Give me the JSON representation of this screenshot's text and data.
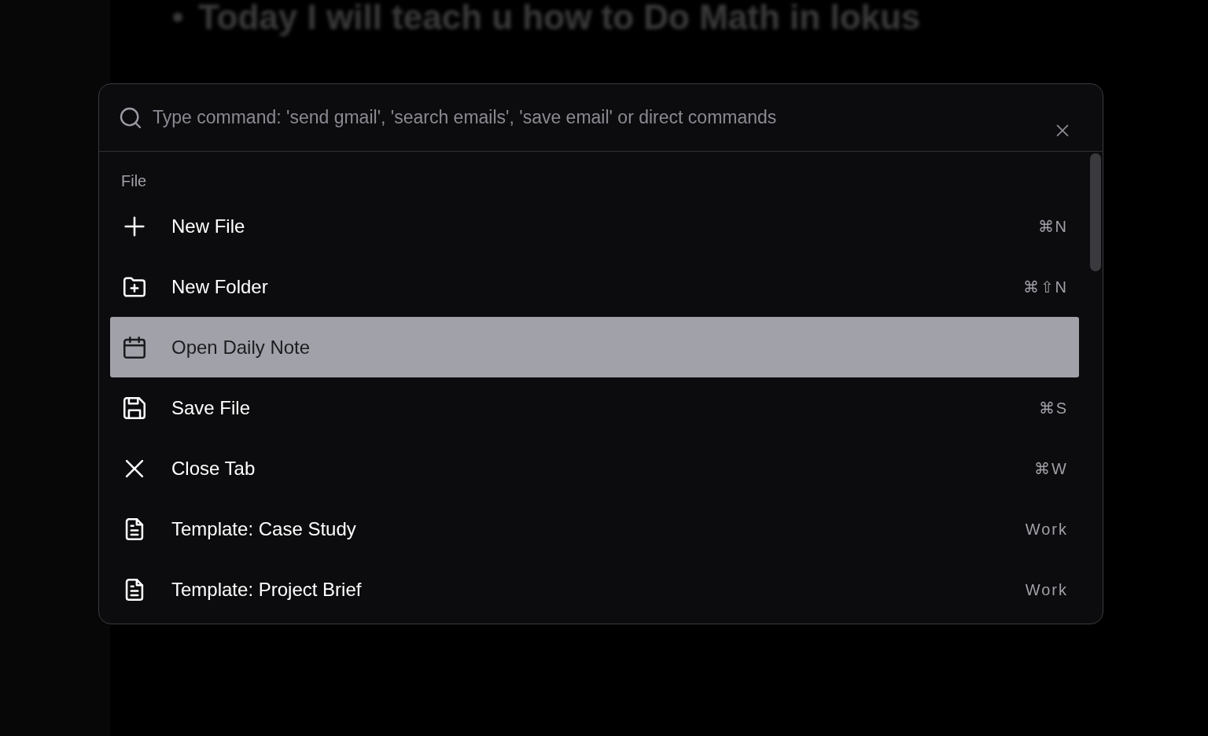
{
  "background": {
    "heading": "Today I will teach u how to Do Math in lokus"
  },
  "palette": {
    "search": {
      "placeholder": "Type command: 'send gmail', 'search emails', 'save email' or direct commands"
    },
    "section": "File",
    "items": [
      {
        "kind": "plus",
        "label": "New File",
        "hint": "⌘N",
        "selected": false
      },
      {
        "kind": "folder",
        "label": "New Folder",
        "hint": "⌘⇧N",
        "selected": false
      },
      {
        "kind": "calendar",
        "label": "Open Daily Note",
        "selected": true
      },
      {
        "kind": "save",
        "label": "Save File",
        "hint": "⌘S",
        "selected": false
      },
      {
        "kind": "close",
        "label": "Close Tab",
        "hint": "⌘W",
        "selected": false
      },
      {
        "kind": "document",
        "label": "Template: Case Study",
        "hint": "Work",
        "selected": false
      },
      {
        "kind": "document",
        "label": "Template: Project Brief",
        "hint": "Work",
        "selected": false
      }
    ]
  }
}
